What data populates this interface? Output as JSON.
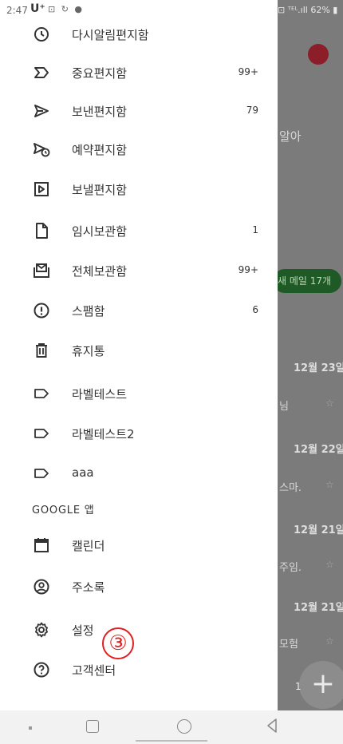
{
  "status_bar": {
    "time": "2:47",
    "carrier": "U⁺",
    "right": "⊡ ᵀᴱᴸ.ıll 62% ▮"
  },
  "drawer": {
    "items": [
      {
        "label": "다시알림편지함",
        "count": "",
        "icon": "snooze-icon"
      },
      {
        "label": "중요편지함",
        "count": "99+",
        "icon": "important-icon"
      },
      {
        "label": "보낸편지함",
        "count": "79",
        "icon": "send-icon"
      },
      {
        "label": "예약편지함",
        "count": "",
        "icon": "scheduled-send-icon"
      },
      {
        "label": "보낼편지함",
        "count": "",
        "icon": "outbox-icon"
      },
      {
        "label": "임시보관함",
        "count": "1",
        "icon": "draft-icon"
      },
      {
        "label": "전체보관함",
        "count": "99+",
        "icon": "all-mail-icon"
      },
      {
        "label": "스팸함",
        "count": "6",
        "icon": "spam-icon"
      },
      {
        "label": "휴지통",
        "count": "",
        "icon": "trash-icon"
      },
      {
        "label": "라벨테스트",
        "count": "",
        "icon": "label-icon"
      },
      {
        "label": "라벨테스트2",
        "count": "",
        "icon": "label-icon"
      },
      {
        "label": "aaa",
        "count": "",
        "icon": "label-icon"
      }
    ],
    "google_section": "GOOGLE 앱",
    "google_items": [
      {
        "label": "캘린더",
        "icon": "calendar-icon"
      },
      {
        "label": "주소록",
        "icon": "contacts-icon"
      }
    ],
    "bottom_items": [
      {
        "label": "설정",
        "icon": "gear-icon"
      },
      {
        "label": "고객센터",
        "icon": "help-icon"
      }
    ],
    "annotation": "③"
  },
  "background": {
    "snippet_1": "알아",
    "new_mail_pill": "새 메일 17개",
    "rows": [
      {
        "date": "12월 23일",
        "snippet": "님"
      },
      {
        "date": "12월 22일",
        "snippet": "스마."
      },
      {
        "date": "12월 21일",
        "snippet": "주임."
      },
      {
        "date": "12월 21일",
        "snippet": "모험"
      }
    ],
    "fab": "+",
    "fab_num": "1"
  },
  "colors": {
    "annotation": "#e02020",
    "scrim": "#7b7b7b",
    "pill": "#1f5a26"
  }
}
